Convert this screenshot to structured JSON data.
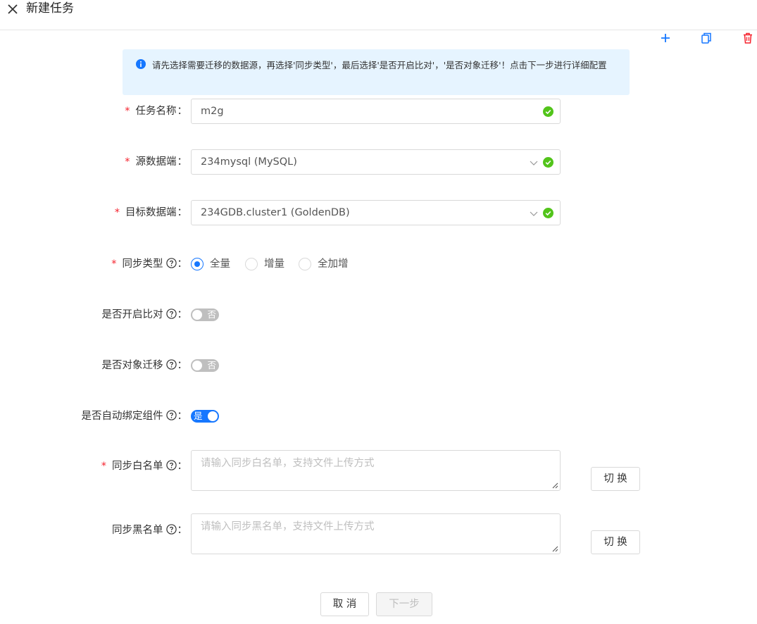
{
  "header": {
    "title": "新建任务"
  },
  "alert": {
    "text": "请先选择需要迁移的数据源，再选择'同步类型'，最后选择'是否开启比对'，'是否对象迁移'！点击下一步进行详细配置"
  },
  "form": {
    "task_name": {
      "label": "任务名称",
      "value": "m2g"
    },
    "source": {
      "label": "源数据端",
      "value": "234mysql (MySQL)"
    },
    "target": {
      "label": "目标数据端",
      "value": "234GDB.cluster1 (GoldenDB)"
    },
    "sync_type": {
      "label": "同步类型",
      "options": [
        "全量",
        "增量",
        "全加增"
      ],
      "selected": "全量"
    },
    "compare": {
      "label": "是否开启比对",
      "state": "否"
    },
    "object_migration": {
      "label": "是否对象迁移",
      "state": "否"
    },
    "auto_bind": {
      "label": "是否自动绑定组件",
      "state": "是"
    },
    "whitelist": {
      "label": "同步白名单",
      "placeholder": "请输入同步白名单，支持文件上传方式",
      "switch_label": "切 换"
    },
    "blacklist": {
      "label": "同步黑名单",
      "placeholder": "请输入同步黑名单，支持文件上传方式",
      "switch_label": "切 换"
    }
  },
  "footer": {
    "cancel_label": "取 消",
    "next_label": "下一步"
  },
  "colors": {
    "primary": "#1677ff",
    "success": "#52c41a",
    "danger": "#f5222d",
    "alert_bg": "#e6f4ff"
  },
  "icons": [
    "close-icon",
    "plus-icon",
    "copy-icon",
    "delete-icon",
    "info-icon",
    "check-circle-icon",
    "chevron-down-icon",
    "question-circle-icon",
    "resize-icon"
  ]
}
